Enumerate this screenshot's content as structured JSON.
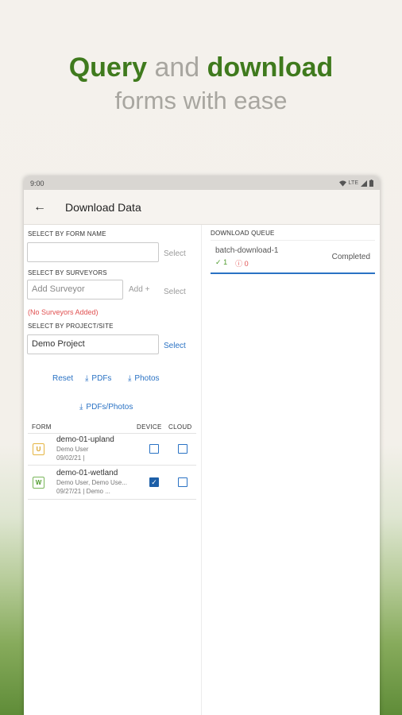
{
  "hero": {
    "word1": "Query",
    "word2": "and",
    "word3": "download",
    "line2": "forms with ease"
  },
  "statusbar": {
    "time": "9:00",
    "network": "LTE"
  },
  "appbar": {
    "title": "Download Data"
  },
  "filters": {
    "form_name_label": "SELECT BY FORM NAME",
    "form_name_value": "",
    "form_select": "Select",
    "surveyors_label": "SELECT BY SURVEYORS",
    "surveyor_placeholder": "Add Surveyor",
    "add_label": "Add",
    "surveyor_select": "Select",
    "no_surveyors": "(No Surveyors Added)",
    "project_label": "SELECT BY PROJECT/SITE",
    "project_value": "Demo Project",
    "project_select": "Select"
  },
  "actions": {
    "reset": "Reset",
    "pdfs": "PDFs",
    "photos": "Photos",
    "pdfs_photos": "PDFs/Photos"
  },
  "table": {
    "headers": [
      "FORM",
      "DEVICE",
      "CLOUD"
    ],
    "rows": [
      {
        "badge": "U",
        "name": "demo-01-upland",
        "user": "Demo User",
        "date": "09/02/21 |",
        "device": false,
        "cloud": false
      },
      {
        "badge": "W",
        "name": "demo-01-wetland",
        "user": "Demo User, Demo Use...",
        "date": "09/27/21 | Demo ...",
        "device": true,
        "cloud": false
      }
    ]
  },
  "queue": {
    "label": "DOWNLOAD QUEUE",
    "items": [
      {
        "name": "batch-download-1",
        "success": "1",
        "errors": "0",
        "status": "Completed"
      }
    ]
  },
  "colors": {
    "brand_green": "#3f7a1d",
    "link_blue": "#2a72c4",
    "error_red": "#e05050"
  }
}
